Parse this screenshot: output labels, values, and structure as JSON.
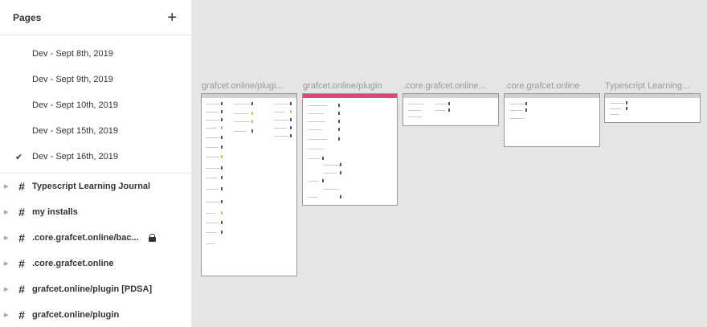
{
  "sidebar": {
    "title": "Pages",
    "add_icon": "plus-icon",
    "pages": [
      {
        "label": "Dev - Sept 8th, 2019",
        "selected": false
      },
      {
        "label": "Dev - Sept 9th, 2019",
        "selected": false
      },
      {
        "label": "Dev - Sept 10th, 2019",
        "selected": false
      },
      {
        "label": "Dev - Sept 15th, 2019",
        "selected": false
      },
      {
        "label": "Dev - Sept 16th, 2019",
        "selected": true
      }
    ],
    "frames": [
      {
        "label": "Typescript Learning Journal",
        "locked": false
      },
      {
        "label": "my installs",
        "locked": false
      },
      {
        "label": ".core.grafcet.online/bac...",
        "locked": true
      },
      {
        "label": ".core.grafcet.online",
        "locked": false
      },
      {
        "label": "grafcet.online/plugin [PDSA]",
        "locked": false
      },
      {
        "label": "grafcet.online/plugin",
        "locked": false
      }
    ]
  },
  "canvas": {
    "frames": [
      {
        "label": "grafcet.online/plugi..."
      },
      {
        "label": "grafcet.online/plugin"
      },
      {
        "label": ".core.grafcet.online..."
      },
      {
        "label": ".core.grafcet.online"
      },
      {
        "label": "Typescript Learning..."
      }
    ]
  },
  "colors": {
    "canvas_bg": "#e5e5e5",
    "accent_pink": "#e0457b"
  }
}
